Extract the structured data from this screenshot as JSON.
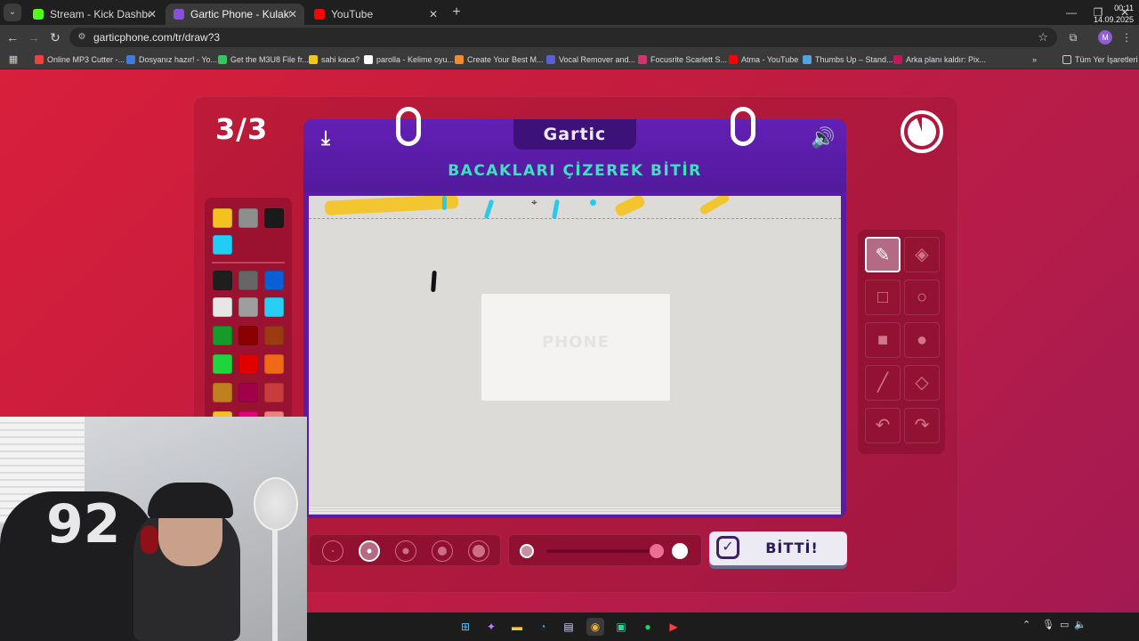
{
  "browser": {
    "tabs": [
      {
        "title": "Stream - Kick Dashboard",
        "favicon_color": "#53fc18",
        "active": false
      },
      {
        "title": "Gartic Phone - Kulaktan Kulağa",
        "favicon_color": "#8a4fd8",
        "active": true
      },
      {
        "title": "YouTube",
        "favicon_color": "#ff0000",
        "active": false
      }
    ],
    "url": "garticphone.com/tr/draw?3",
    "bookmarks": [
      {
        "label": "Online MP3 Cutter -...",
        "color": "#e8453c"
      },
      {
        "label": "Dosyanız hazır! - Yo...",
        "color": "#3b7ddd"
      },
      {
        "label": "Get the M3U8 File fr...",
        "color": "#34c759"
      },
      {
        "label": "sahi kaca?",
        "color": "#f5c518"
      },
      {
        "label": "parolla - Kelime oyu...",
        "color": "#ffffff"
      },
      {
        "label": "Create Your Best M...",
        "color": "#f28b30"
      },
      {
        "label": "Vocal Remover and...",
        "color": "#5b5fd6"
      },
      {
        "label": "Focusrite Scarlett S...",
        "color": "#d6336c"
      },
      {
        "label": "Atma - YouTube",
        "color": "#ff0000"
      },
      {
        "label": "Thumbs Up – Stand...",
        "color": "#4fa3e0"
      },
      {
        "label": "Arka planı kaldır: Pix...",
        "color": "#c2185b"
      }
    ],
    "all_bookmarks_label": "Tüm Yer İşaretleri"
  },
  "game": {
    "round": "3/3",
    "logo": "Gartic",
    "instruction": "BACAKLARI ÇİZEREK BİTİR",
    "watermark": "PHONE",
    "done_label": "BİTTİ!",
    "timer_fraction_remaining": 0.94,
    "palette": [
      "#f5c022",
      "#8e8e8e",
      "#1a1a1a",
      "#22ccf5",
      "#1e1e1e",
      "#666666",
      "#0a5fd4",
      "#e6e6e6",
      "#9e9e9e",
      "#28cff5",
      "#149b2a",
      "#8b0000",
      "#9c3b12",
      "#20d43e",
      "#e00000",
      "#ef6a14",
      "#c08020",
      "#a3004a",
      "#c93c3c",
      "#f5c022",
      "#e6007a",
      "#ef8080"
    ],
    "tools": [
      "pencil-icon",
      "eraser-icon",
      "rectangle-icon",
      "ellipse-icon",
      "filled-rectangle-icon",
      "filled-ellipse-icon",
      "line-icon",
      "fill-bucket-icon",
      "undo-icon",
      "redo-icon"
    ],
    "brush_sizes": 5,
    "selected_brush_size": 2,
    "opacity_fraction": 0.95
  },
  "taskbar": {
    "time": "00:11",
    "date": "14.09.2025"
  }
}
